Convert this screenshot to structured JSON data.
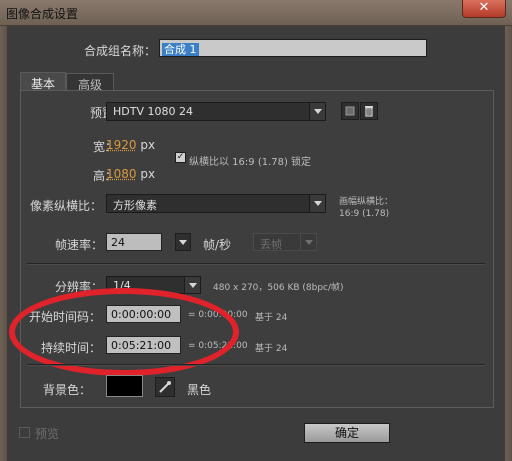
{
  "window": {
    "title": "图像合成设置",
    "close_glyph": "✕"
  },
  "comp_name": {
    "label": "合成组名称：",
    "value": "合成 1"
  },
  "tabs": [
    {
      "label": "基本"
    },
    {
      "label": "高级"
    }
  ],
  "preset": {
    "label": "预置：",
    "value": "HDTV 1080 24"
  },
  "width": {
    "label": "宽：",
    "value": "1920",
    "unit": "px"
  },
  "height": {
    "label": "高：",
    "value": "1080",
    "unit": "px"
  },
  "lock_ratio": {
    "label": "纵横比以 16:9 (1.78) 锁定",
    "checked": true
  },
  "pixel_aspect": {
    "label": "像素纵横比：",
    "value": "方形像素",
    "frame_aspect_label": "画幅纵横比：",
    "frame_aspect_value": "16:9 (1.78)"
  },
  "frame_rate": {
    "label": "帧速率：",
    "value": "24",
    "unit": "帧/秒",
    "drop_frame": "丢帧"
  },
  "resolution": {
    "label": "分辨率：",
    "value": "1/4",
    "info": "480 x 270，506 KB (8bpc/帧)"
  },
  "start_timecode": {
    "label": "开始时间码：",
    "value": "0:00:00:00",
    "equals": "= 0:00:00:00",
    "base": "基于 24"
  },
  "duration": {
    "label": "持续时间：",
    "value": "0:05:21:00",
    "equals": "= 0:05:21:00",
    "base": "基于 24"
  },
  "background": {
    "label": "背景色：",
    "color": "#000000",
    "color_name": "黑色"
  },
  "footer": {
    "preview_label": "预览",
    "ok_label": "确定"
  },
  "colors": {
    "annotation": "#e0232a",
    "link": "#d99a3c",
    "selection": "#3b80c6"
  }
}
